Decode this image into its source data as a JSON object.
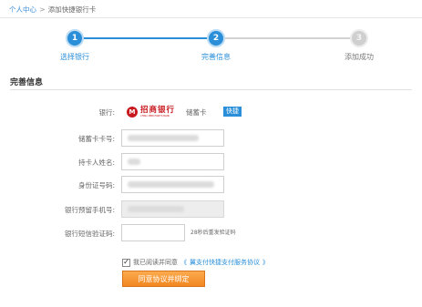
{
  "breadcrumb": {
    "parent": "个人中心",
    "separator": ">",
    "current": "添加快捷银行卡"
  },
  "steps": [
    {
      "number": "1",
      "label": "选择银行",
      "state": "done"
    },
    {
      "number": "2",
      "label": "完善信息",
      "state": "current"
    },
    {
      "number": "3",
      "label": "添加成功",
      "state": "pending"
    }
  ],
  "section": {
    "title": "完善信息"
  },
  "form": {
    "bank_label": "银行:",
    "bank_name": "招商银行",
    "bank_name_en": "CHINA MERCHANTS BANK",
    "bank_emblem": "M",
    "card_type": "储蓄卡",
    "quick_badge": "快捷",
    "card_number_label": "储蓄卡卡号:",
    "holder_name_label": "持卡人姓名:",
    "id_number_label": "身份证号码:",
    "phone_label": "银行预留手机号:",
    "sms_label": "银行短信验证码:",
    "sms_hint": "28秒后重发验证码"
  },
  "agreement": {
    "checked": true,
    "check_mark": "✓",
    "prefix": "我已阅读并同意",
    "open_quote": "《",
    "link_text": "翼支付快捷支付服务协议",
    "close_quote": "》"
  },
  "submit_label": "同意协议并绑定",
  "colors": {
    "accent_blue": "#2a8fd8",
    "bank_red": "#c8191f",
    "button_orange": "#f2871f",
    "step_pending": "#cfcfcf"
  }
}
